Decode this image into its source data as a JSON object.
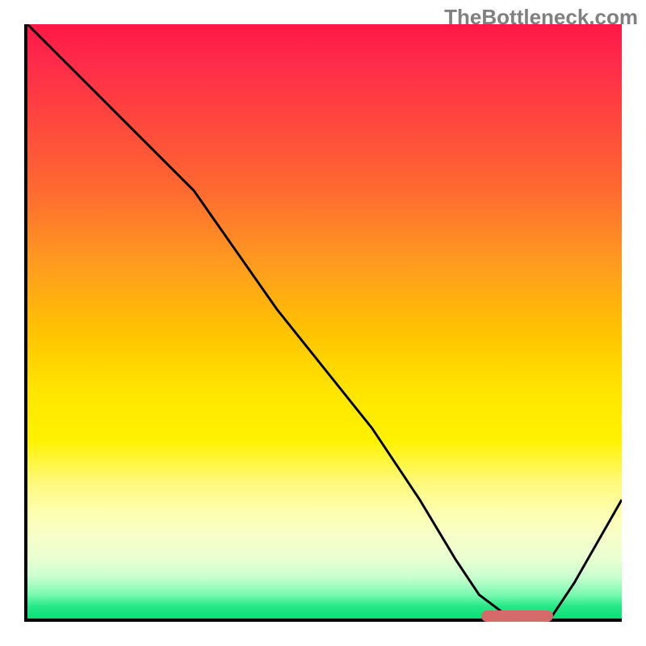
{
  "watermark": "TheBottleneck.com",
  "colors": {
    "axis": "#000000",
    "curve": "#000000",
    "marker": "#d46a6a",
    "watermark_text": "#808080"
  },
  "chart_data": {
    "type": "line",
    "title": "",
    "xlabel": "",
    "ylabel": "",
    "xlim": [
      0,
      100
    ],
    "ylim": [
      0,
      100
    ],
    "grid": false,
    "legend": false,
    "background": "red-yellow-green vertical gradient (bottleneck heat)",
    "series": [
      {
        "name": "bottleneck-curve",
        "x": [
          0,
          8,
          16,
          22,
          28,
          35,
          42,
          50,
          58,
          66,
          72,
          76,
          80,
          84,
          88,
          92,
          96,
          100
        ],
        "y": [
          100,
          92,
          84,
          78,
          72,
          62,
          52,
          42,
          32,
          20,
          10,
          4,
          1,
          0,
          0,
          6,
          13,
          20
        ]
      }
    ],
    "annotations": [
      {
        "name": "optimal-range-marker",
        "shape": "pill",
        "x_range": [
          76,
          88
        ],
        "y": 1,
        "color": "#d46a6a"
      }
    ]
  }
}
